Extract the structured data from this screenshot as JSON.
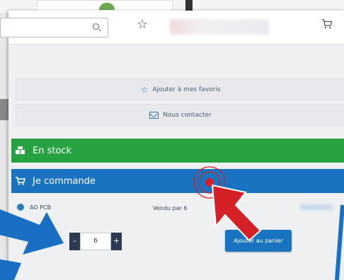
{
  "colors": {
    "stock_green": "#27a243",
    "order_blue": "#1a73c0",
    "qty_dark": "#2b3a52",
    "annotation_red": "#d62027",
    "annotation_blue": "#1a6ec4"
  },
  "header": {
    "search_icon": "search-icon",
    "favorite_icon": "star-icon",
    "cart_icon": "cart-icon"
  },
  "actions": {
    "favorites_label": "Ajouter à mes favoris",
    "contact_label": "Nous contacter"
  },
  "stock": {
    "label": "En stock",
    "icon": "boxes-icon"
  },
  "order": {
    "label": "Je commande",
    "icon": "cart-icon"
  },
  "seller": {
    "name": "AO PCB",
    "sold_by": "Vendu par 6"
  },
  "quantity": {
    "minus": "-",
    "value": "6",
    "plus": "+"
  },
  "cart": {
    "add_label": "Ajouter au panier"
  }
}
